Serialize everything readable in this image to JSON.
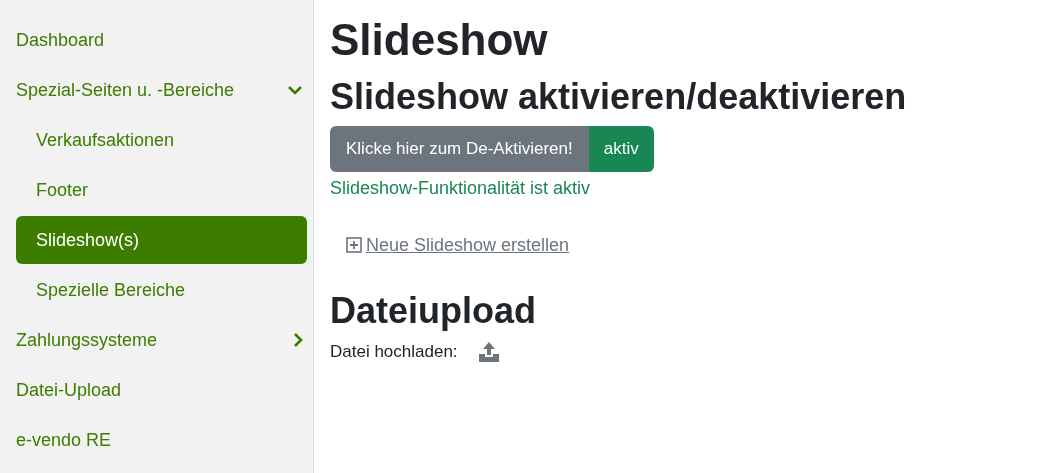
{
  "sidebar": {
    "items": [
      {
        "label": "Dashboard",
        "selected": false
      },
      {
        "label": "Spezial-Seiten u. -Bereiche",
        "selected": false,
        "expanded": true,
        "children": [
          {
            "label": "Verkaufsaktionen",
            "selected": false
          },
          {
            "label": "Footer",
            "selected": false
          },
          {
            "label": "Slideshow(s)",
            "selected": true
          },
          {
            "label": "Spezielle Bereiche",
            "selected": false
          }
        ]
      },
      {
        "label": "Zahlungssysteme",
        "selected": false,
        "expanded": false
      },
      {
        "label": "Datei-Upload",
        "selected": false
      },
      {
        "label": "e-vendo RE",
        "selected": false
      }
    ]
  },
  "main": {
    "title": "Slideshow",
    "toggle_section": {
      "heading": "Slideshow aktivieren/deaktivieren",
      "button": "Klicke hier zum De-Aktivieren!",
      "badge": "aktiv",
      "active": true,
      "message": "Slideshow-Funktionalität ist aktiv"
    },
    "new_link": "Neue Slideshow erstellen",
    "upload_section": {
      "heading": "Dateiupload",
      "label": "Datei hochladen:"
    }
  }
}
